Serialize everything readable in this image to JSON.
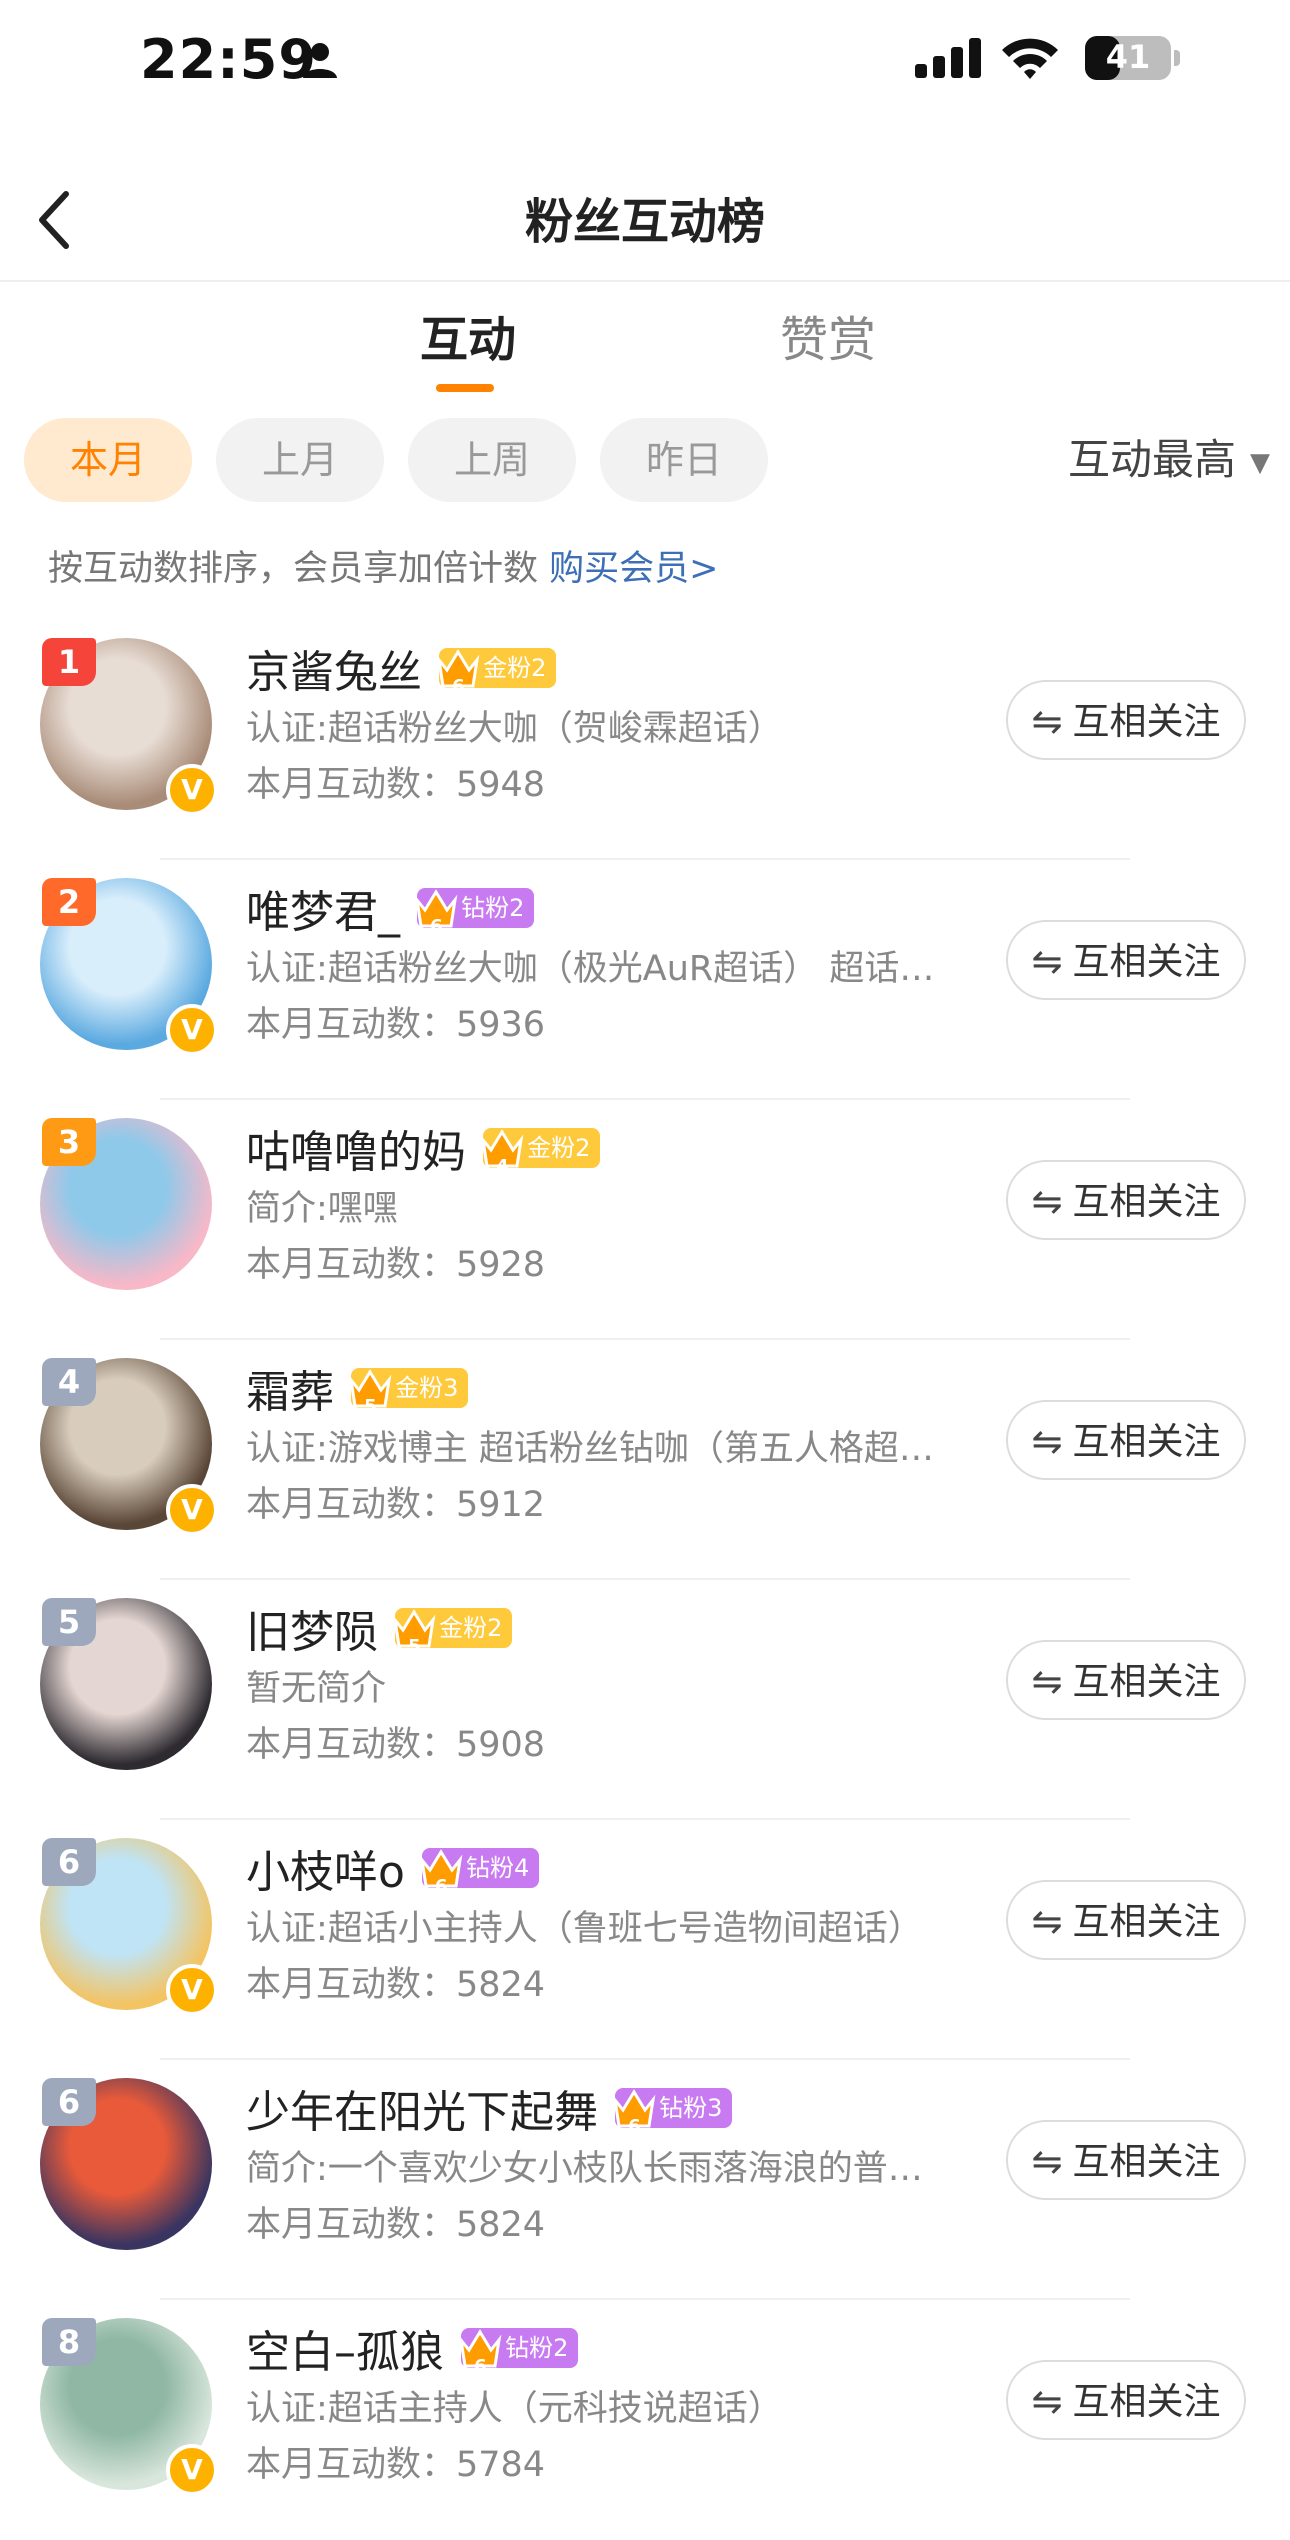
{
  "status_bar": {
    "time": "22:59",
    "battery": "41",
    "battery_level": 0.41
  },
  "nav": {
    "title": "粉丝互动榜",
    "back_icon": "chevron-left-icon"
  },
  "tabs": [
    {
      "label": "互动",
      "active": true
    },
    {
      "label": "赞赏",
      "active": false
    }
  ],
  "filters": [
    {
      "label": "本月",
      "active": true
    },
    {
      "label": "上月",
      "active": false
    },
    {
      "label": "上周",
      "active": false
    },
    {
      "label": "昨日",
      "active": false
    }
  ],
  "sort": {
    "label": "互动最高"
  },
  "hint": {
    "text": "按互动数排序，会员享加倍计数",
    "link": "购买会员>"
  },
  "colors": {
    "accent": "#ff8200",
    "link": "#3c6fb5",
    "rank1": "#f5453a",
    "rank2": "#ff6a2b",
    "rank3": "#ff9a14",
    "rank_other": "#9ea8bd",
    "gold_badge": "#ffc93c",
    "diamond_badge": "#c87bf0"
  },
  "follow_label": "互相关注",
  "users": [
    {
      "rank": "1",
      "name": "京酱兔丝",
      "badge_text": "金粉2",
      "badge_level": "6",
      "badge_type": "gold",
      "verified": true,
      "desc": "认证:超话粉丝大咖（贺峻霖超话）",
      "count": "本月互动数：5948",
      "avatar_colors": [
        "#a98c78",
        "#e8ddd5"
      ]
    },
    {
      "rank": "2",
      "name": "唯梦君_",
      "badge_text": "钻粉2",
      "badge_level": "6",
      "badge_type": "diamond",
      "verified": true,
      "desc": "认证:超话粉丝大咖（极光AuR超话） 超话…",
      "count": "本月互动数：5936",
      "avatar_colors": [
        "#5aa9e0",
        "#d9eefb"
      ]
    },
    {
      "rank": "3",
      "name": "咕噜噜的妈",
      "badge_text": "金粉2",
      "badge_level": "4",
      "badge_type": "gold",
      "verified": false,
      "desc": "简介:嘿嘿",
      "count": "本月互动数：5928",
      "avatar_colors": [
        "#f7b8c8",
        "#8ec9ea"
      ]
    },
    {
      "rank": "4",
      "name": "霜葬",
      "badge_text": "金粉3",
      "badge_level": "5",
      "badge_type": "gold",
      "verified": true,
      "desc": "认证:游戏博主 超话粉丝钻咖（第五人格超…",
      "count": "本月互动数：5912",
      "avatar_colors": [
        "#5a4636",
        "#d8ccbc"
      ]
    },
    {
      "rank": "5",
      "name": "旧梦陨",
      "badge_text": "金粉2",
      "badge_level": "5",
      "badge_type": "gold",
      "verified": false,
      "desc": "暂无简介",
      "count": "本月互动数：5908",
      "avatar_colors": [
        "#2d2a30",
        "#e4d6d2"
      ]
    },
    {
      "rank": "6",
      "name": "小枝咩o",
      "badge_text": "钻粉4",
      "badge_level": "6",
      "badge_type": "diamond",
      "verified": true,
      "desc": "认证:超话小主持人（鲁班七号造物间超话）",
      "count": "本月互动数：5824",
      "avatar_colors": [
        "#f3c463",
        "#bfe4f6"
      ]
    },
    {
      "rank": "6",
      "name": "少年在阳光下起舞",
      "badge_text": "钻粉3",
      "badge_level": "6",
      "badge_type": "diamond",
      "verified": false,
      "desc": "简介:一个喜欢少女小枝队长雨落海浪的普…",
      "count": "本月互动数：5824",
      "avatar_colors": [
        "#3a3560",
        "#e85a3a"
      ]
    },
    {
      "rank": "8",
      "name": "空白–孤狼",
      "badge_text": "钻粉2",
      "badge_level": "6",
      "badge_type": "diamond",
      "verified": true,
      "desc": "认证:超话主持人（元科技说超话）",
      "count": "本月互动数：5784",
      "avatar_colors": [
        "#d9e6dc",
        "#8fb7a4"
      ]
    }
  ]
}
